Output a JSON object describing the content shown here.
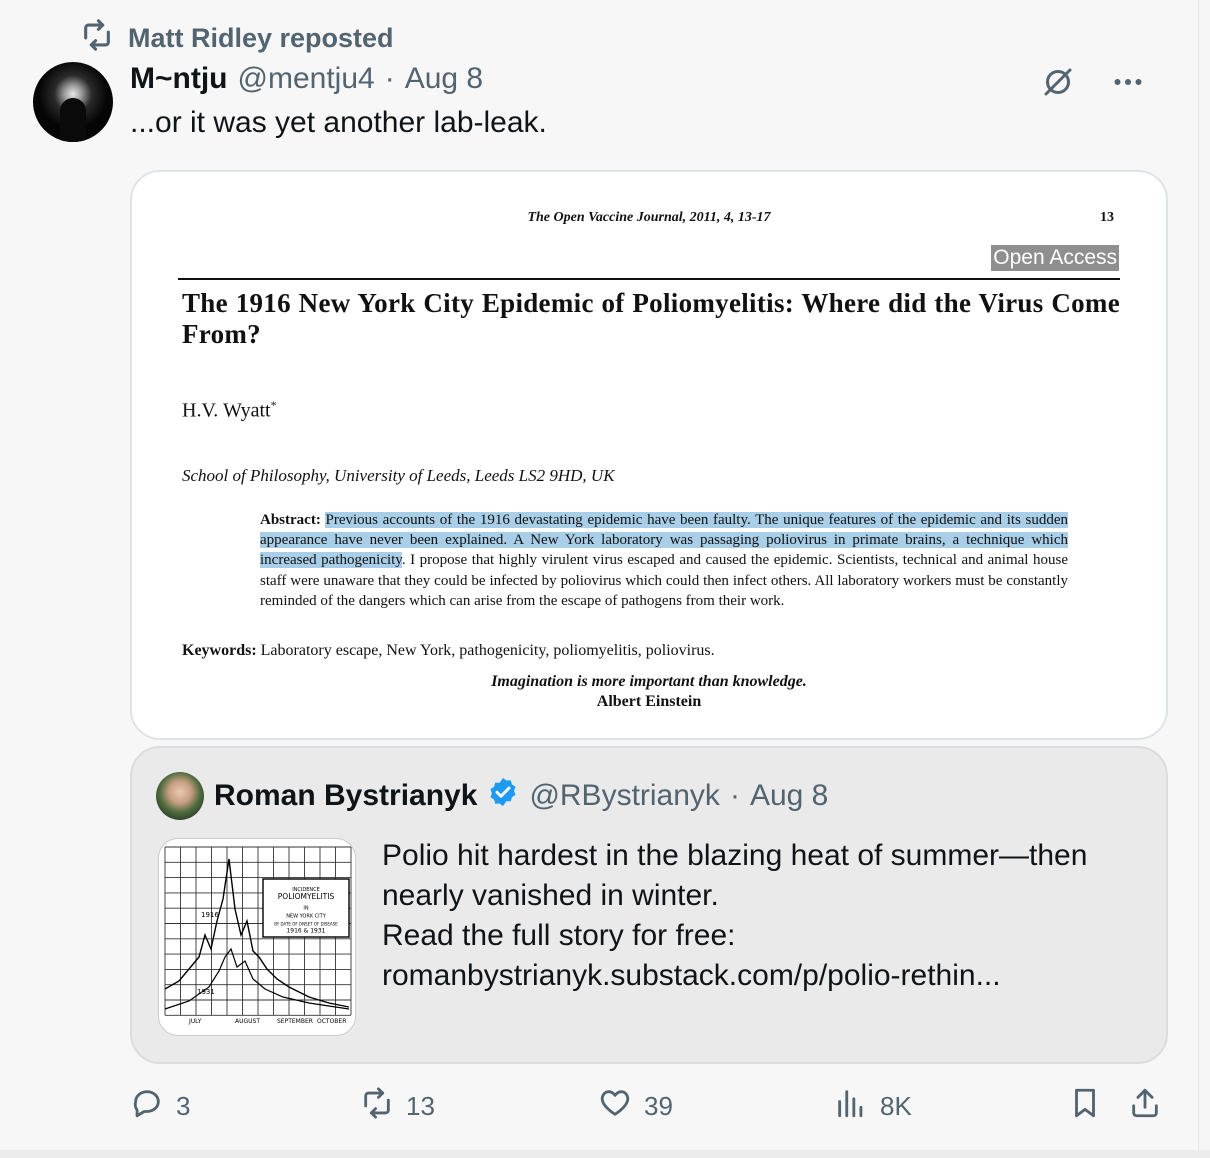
{
  "repost": {
    "label": "Matt Ridley reposted",
    "icon": "repost-icon"
  },
  "post": {
    "author_name": "M~ntju",
    "handle": "@mentju4",
    "separator": "·",
    "date": "Aug 8",
    "text": "...or it was yet another lab-leak."
  },
  "document": {
    "journal": "The Open Vaccine Journal, 2011, 4, 13-17",
    "page_number": "13",
    "open_access": "Open Access",
    "title": "The 1916 New York City Epidemic of Poliomyelitis: Where did the Virus Come From?",
    "author": "H.V. Wyatt",
    "author_mark": "*",
    "affiliation": "School of Philosophy, University of Leeds, Leeds LS2 9HD, UK",
    "abstract_label": "Abstract:",
    "abstract_highlighted": "Previous accounts of the 1916 devastating epidemic have been faulty. The unique features of the epidemic and its sudden appearance have never been explained. A New York laboratory was passaging poliovirus in primate brains, a technique which increased pathogenicity",
    "abstract_rest": ". I propose that highly virulent virus escaped and caused the epidemic. Scientists, technical and animal house staff were unaware that they could be infected by poliovirus which could then infect others. All laboratory workers must be constantly reminded of the dangers which can arise from the escape of pathogens from their work.",
    "keywords_label": "Keywords:",
    "keywords": "Laboratory escape, New York, pathogenicity, poliomyelitis, poliovirus.",
    "quote": "Imagination is more important than knowledge.",
    "quote_author": "Albert Einstein"
  },
  "quoted_post": {
    "author_name": "Roman Bystrianyk",
    "verified": true,
    "handle": "@RBystrianyk",
    "separator": "·",
    "date": "Aug 8",
    "lines": [
      "Polio hit hardest in the blazing heat of summer—then",
      "nearly vanished in winter.",
      "Read the full story for free:",
      "romanbystrianyk.substack.com/p/polio-rethin..."
    ],
    "thumbnail": {
      "box_lines": [
        "INCIDENCE",
        "POLIOMYELITIS",
        "IN",
        "NEW YORK CITY",
        "BY DATE OF ONSET OF DISEASE",
        "1916 & 1931"
      ],
      "year_labels": [
        "1916",
        "1931"
      ],
      "month_labels": [
        "JULY",
        "AUGUST",
        "SEPTEMBER",
        "OCTOBER"
      ]
    }
  },
  "actions": {
    "replies": "3",
    "reposts": "13",
    "likes": "39",
    "views": "8K"
  },
  "colors": {
    "secondary_text": "#536471",
    "verified": "#1d9bf0",
    "highlight": "#a9cfe8"
  }
}
